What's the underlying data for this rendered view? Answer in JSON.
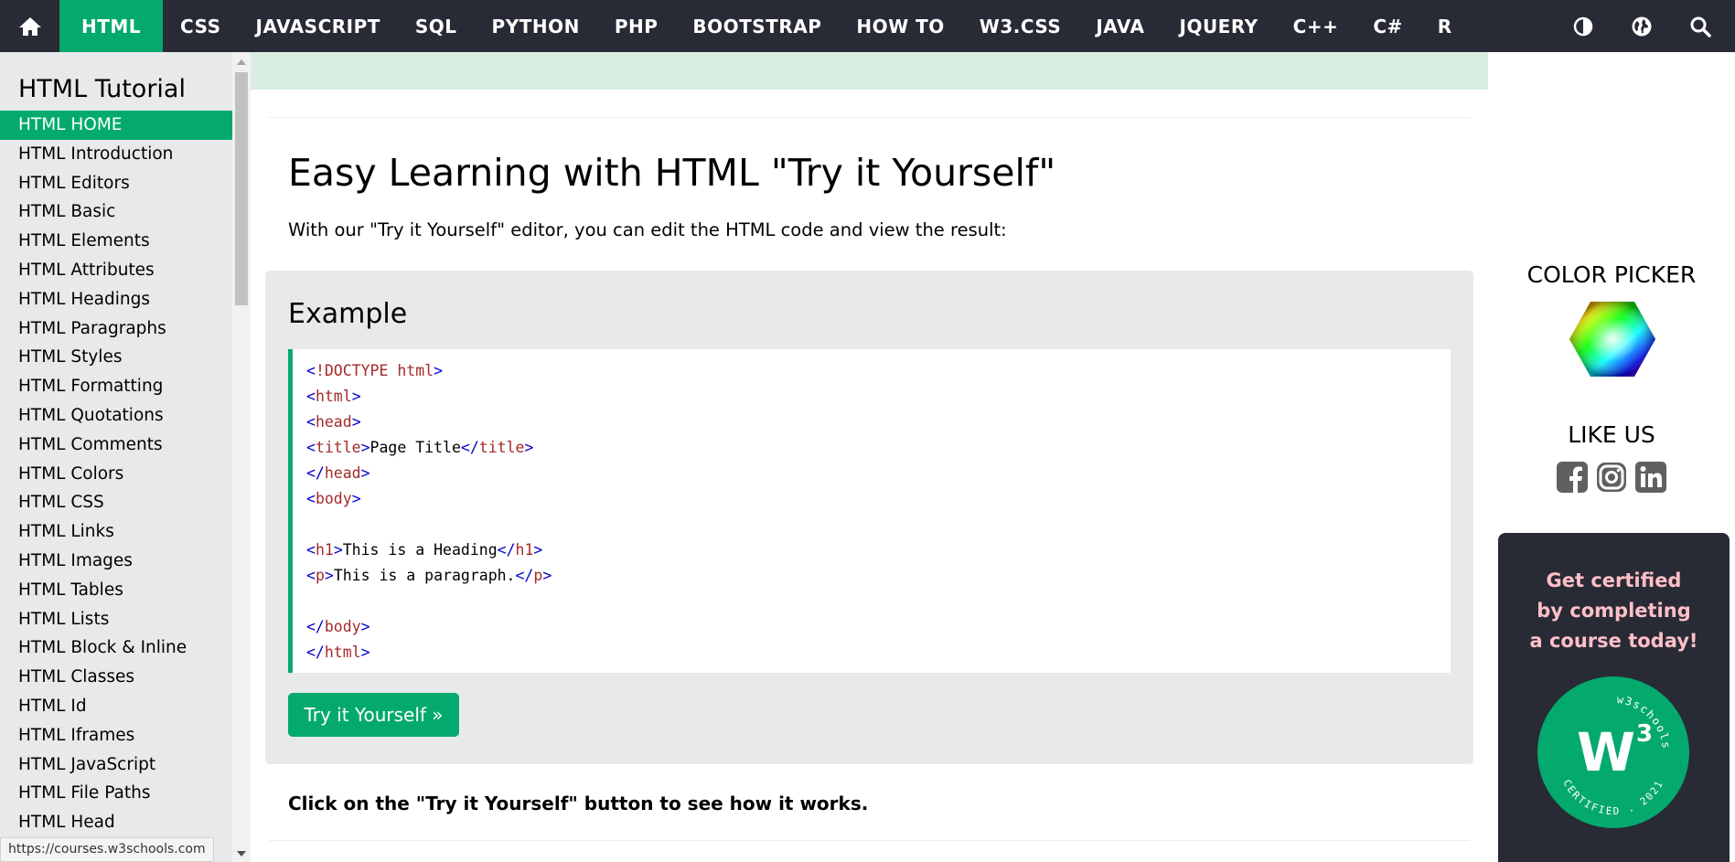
{
  "topnav": {
    "items": [
      "HTML",
      "CSS",
      "JAVASCRIPT",
      "SQL",
      "PYTHON",
      "PHP",
      "BOOTSTRAP",
      "HOW TO",
      "W3.CSS",
      "JAVA",
      "JQUERY",
      "C++",
      "C#",
      "R"
    ],
    "active": "HTML",
    "icons": [
      "home-icon",
      "contrast-icon",
      "globe-icon",
      "search-icon"
    ]
  },
  "sidebar": {
    "title": "HTML Tutorial",
    "items": [
      "HTML HOME",
      "HTML Introduction",
      "HTML Editors",
      "HTML Basic",
      "HTML Elements",
      "HTML Attributes",
      "HTML Headings",
      "HTML Paragraphs",
      "HTML Styles",
      "HTML Formatting",
      "HTML Quotations",
      "HTML Comments",
      "HTML Colors",
      "HTML CSS",
      "HTML Links",
      "HTML Images",
      "HTML Tables",
      "HTML Lists",
      "HTML Block & Inline",
      "HTML Classes",
      "HTML Id",
      "HTML Iframes",
      "HTML JavaScript",
      "HTML File Paths",
      "HTML Head"
    ],
    "active": "HTML HOME"
  },
  "statusbar": {
    "url": "https://courses.w3schools.com"
  },
  "main": {
    "heading": "Easy Learning with HTML \"Try it Yourself\"",
    "intro": "With our \"Try it Yourself\" editor, you can edit the HTML code and view the result:",
    "example_title": "Example",
    "code_lines": [
      [
        [
          "b",
          "<"
        ],
        [
          "t",
          "!DOCTYPE "
        ],
        [
          "t",
          "html"
        ],
        [
          "b",
          ">"
        ]
      ],
      [
        [
          "b",
          "<"
        ],
        [
          "t",
          "html"
        ],
        [
          "b",
          ">"
        ]
      ],
      [
        [
          "b",
          "<"
        ],
        [
          "t",
          "head"
        ],
        [
          "b",
          ">"
        ]
      ],
      [
        [
          "b",
          "<"
        ],
        [
          "t",
          "title"
        ],
        [
          "b",
          ">"
        ],
        [
          "txt",
          "Page Title"
        ],
        [
          "b",
          "</"
        ],
        [
          "t",
          "title"
        ],
        [
          "b",
          ">"
        ]
      ],
      [
        [
          "b",
          "</"
        ],
        [
          "t",
          "head"
        ],
        [
          "b",
          ">"
        ]
      ],
      [
        [
          "b",
          "<"
        ],
        [
          "t",
          "body"
        ],
        [
          "b",
          ">"
        ]
      ],
      [],
      [
        [
          "b",
          "<"
        ],
        [
          "t",
          "h1"
        ],
        [
          "b",
          ">"
        ],
        [
          "txt",
          "This is a Heading"
        ],
        [
          "b",
          "</"
        ],
        [
          "t",
          "h1"
        ],
        [
          "b",
          ">"
        ]
      ],
      [
        [
          "b",
          "<"
        ],
        [
          "t",
          "p"
        ],
        [
          "b",
          ">"
        ],
        [
          "txt",
          "This is a paragraph."
        ],
        [
          "b",
          "</"
        ],
        [
          "t",
          "p"
        ],
        [
          "b",
          ">"
        ]
      ],
      [],
      [
        [
          "b",
          "</"
        ],
        [
          "t",
          "body"
        ],
        [
          "b",
          ">"
        ]
      ],
      [
        [
          "b",
          "</"
        ],
        [
          "t",
          "html"
        ],
        [
          "b",
          ">"
        ]
      ]
    ],
    "try_button": "Try it Yourself »",
    "click_text": "Click on the \"Try it Yourself\" button to see how it works."
  },
  "rightcol": {
    "color_picker_title": "COLOR PICKER",
    "like_title": "LIKE US",
    "social": [
      "facebook-icon",
      "instagram-icon",
      "linkedin-icon"
    ],
    "cert_lines": [
      "Get certified",
      "by completing",
      "a course today!"
    ],
    "badge_top": "w3schools",
    "badge_bottom": "CERTIFIED . 2021",
    "badge_mark": "W",
    "badge_sup": "3"
  },
  "colors": {
    "nav_bg": "#282A35",
    "accent": "#04AA6D",
    "sidebar_bg": "#E7E9EB",
    "cert_text": "#FFC0C7",
    "green_band": "#D9EEE1"
  }
}
